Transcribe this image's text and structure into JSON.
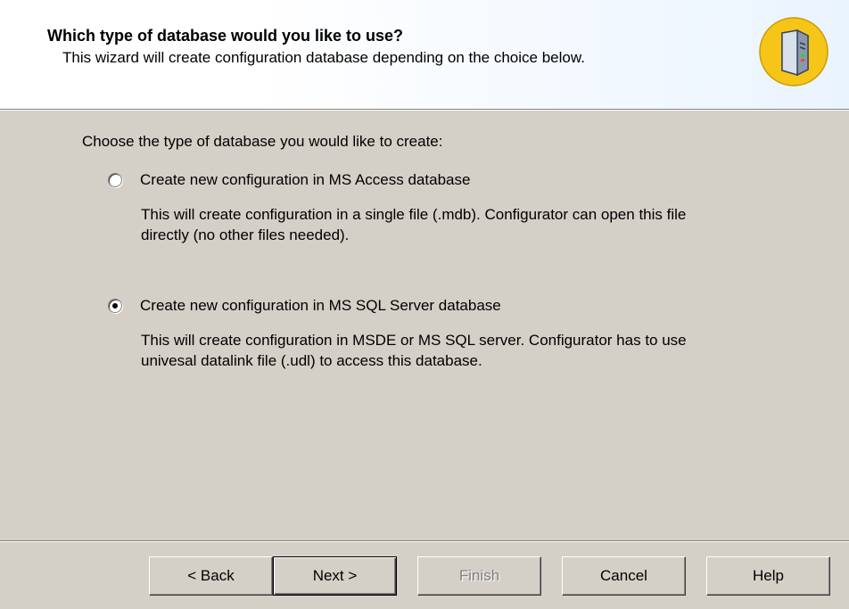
{
  "header": {
    "title": "Which type of database would you like to use?",
    "subtitle": "This wizard will create configuration database depending on the choice below.",
    "icon": "database-server-icon"
  },
  "main": {
    "prompt": "Choose the type of database you would like to create:",
    "options": [
      {
        "label": "Create new configuration in MS Access database",
        "description_line1": "This will create configuration in a single file (.mdb). Configurator can open this file",
        "description_line2": "directly (no other files needed).",
        "selected": false
      },
      {
        "label": "Create new configuration in MS SQL Server database",
        "description_line1": "This will create configuration in MSDE or MS SQL server. Configurator has to use",
        "description_line2": "univesal datalink file (.udl) to access this database.",
        "selected": true
      }
    ]
  },
  "buttons": {
    "back": "< Back",
    "next": "Next >",
    "finish": "Finish",
    "cancel": "Cancel",
    "help": "Help"
  },
  "colors": {
    "dialog_bg": "#d4d0c8",
    "icon_circle": "#f5c518"
  }
}
